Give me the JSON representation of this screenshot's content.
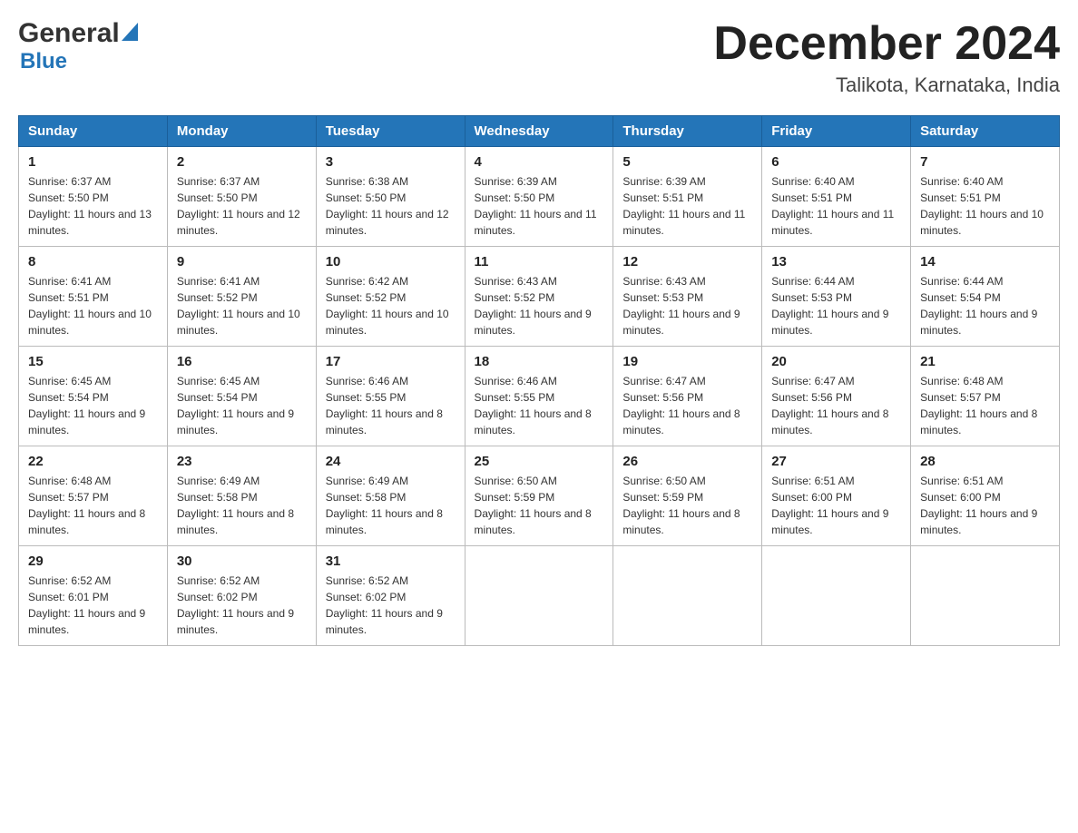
{
  "header": {
    "logo_general": "General",
    "logo_blue": "Blue",
    "month_title": "December 2024",
    "location": "Talikota, Karnataka, India"
  },
  "days_of_week": [
    "Sunday",
    "Monday",
    "Tuesday",
    "Wednesday",
    "Thursday",
    "Friday",
    "Saturday"
  ],
  "weeks": [
    [
      {
        "day": "1",
        "sunrise": "6:37 AM",
        "sunset": "5:50 PM",
        "daylight": "11 hours and 13 minutes."
      },
      {
        "day": "2",
        "sunrise": "6:37 AM",
        "sunset": "5:50 PM",
        "daylight": "11 hours and 12 minutes."
      },
      {
        "day": "3",
        "sunrise": "6:38 AM",
        "sunset": "5:50 PM",
        "daylight": "11 hours and 12 minutes."
      },
      {
        "day": "4",
        "sunrise": "6:39 AM",
        "sunset": "5:50 PM",
        "daylight": "11 hours and 11 minutes."
      },
      {
        "day": "5",
        "sunrise": "6:39 AM",
        "sunset": "5:51 PM",
        "daylight": "11 hours and 11 minutes."
      },
      {
        "day": "6",
        "sunrise": "6:40 AM",
        "sunset": "5:51 PM",
        "daylight": "11 hours and 11 minutes."
      },
      {
        "day": "7",
        "sunrise": "6:40 AM",
        "sunset": "5:51 PM",
        "daylight": "11 hours and 10 minutes."
      }
    ],
    [
      {
        "day": "8",
        "sunrise": "6:41 AM",
        "sunset": "5:51 PM",
        "daylight": "11 hours and 10 minutes."
      },
      {
        "day": "9",
        "sunrise": "6:41 AM",
        "sunset": "5:52 PM",
        "daylight": "11 hours and 10 minutes."
      },
      {
        "day": "10",
        "sunrise": "6:42 AM",
        "sunset": "5:52 PM",
        "daylight": "11 hours and 10 minutes."
      },
      {
        "day": "11",
        "sunrise": "6:43 AM",
        "sunset": "5:52 PM",
        "daylight": "11 hours and 9 minutes."
      },
      {
        "day": "12",
        "sunrise": "6:43 AM",
        "sunset": "5:53 PM",
        "daylight": "11 hours and 9 minutes."
      },
      {
        "day": "13",
        "sunrise": "6:44 AM",
        "sunset": "5:53 PM",
        "daylight": "11 hours and 9 minutes."
      },
      {
        "day": "14",
        "sunrise": "6:44 AM",
        "sunset": "5:54 PM",
        "daylight": "11 hours and 9 minutes."
      }
    ],
    [
      {
        "day": "15",
        "sunrise": "6:45 AM",
        "sunset": "5:54 PM",
        "daylight": "11 hours and 9 minutes."
      },
      {
        "day": "16",
        "sunrise": "6:45 AM",
        "sunset": "5:54 PM",
        "daylight": "11 hours and 9 minutes."
      },
      {
        "day": "17",
        "sunrise": "6:46 AM",
        "sunset": "5:55 PM",
        "daylight": "11 hours and 8 minutes."
      },
      {
        "day": "18",
        "sunrise": "6:46 AM",
        "sunset": "5:55 PM",
        "daylight": "11 hours and 8 minutes."
      },
      {
        "day": "19",
        "sunrise": "6:47 AM",
        "sunset": "5:56 PM",
        "daylight": "11 hours and 8 minutes."
      },
      {
        "day": "20",
        "sunrise": "6:47 AM",
        "sunset": "5:56 PM",
        "daylight": "11 hours and 8 minutes."
      },
      {
        "day": "21",
        "sunrise": "6:48 AM",
        "sunset": "5:57 PM",
        "daylight": "11 hours and 8 minutes."
      }
    ],
    [
      {
        "day": "22",
        "sunrise": "6:48 AM",
        "sunset": "5:57 PM",
        "daylight": "11 hours and 8 minutes."
      },
      {
        "day": "23",
        "sunrise": "6:49 AM",
        "sunset": "5:58 PM",
        "daylight": "11 hours and 8 minutes."
      },
      {
        "day": "24",
        "sunrise": "6:49 AM",
        "sunset": "5:58 PM",
        "daylight": "11 hours and 8 minutes."
      },
      {
        "day": "25",
        "sunrise": "6:50 AM",
        "sunset": "5:59 PM",
        "daylight": "11 hours and 8 minutes."
      },
      {
        "day": "26",
        "sunrise": "6:50 AM",
        "sunset": "5:59 PM",
        "daylight": "11 hours and 8 minutes."
      },
      {
        "day": "27",
        "sunrise": "6:51 AM",
        "sunset": "6:00 PM",
        "daylight": "11 hours and 9 minutes."
      },
      {
        "day": "28",
        "sunrise": "6:51 AM",
        "sunset": "6:00 PM",
        "daylight": "11 hours and 9 minutes."
      }
    ],
    [
      {
        "day": "29",
        "sunrise": "6:52 AM",
        "sunset": "6:01 PM",
        "daylight": "11 hours and 9 minutes."
      },
      {
        "day": "30",
        "sunrise": "6:52 AM",
        "sunset": "6:02 PM",
        "daylight": "11 hours and 9 minutes."
      },
      {
        "day": "31",
        "sunrise": "6:52 AM",
        "sunset": "6:02 PM",
        "daylight": "11 hours and 9 minutes."
      },
      null,
      null,
      null,
      null
    ]
  ],
  "sunrise_label": "Sunrise:",
  "sunset_label": "Sunset:",
  "daylight_label": "Daylight:"
}
